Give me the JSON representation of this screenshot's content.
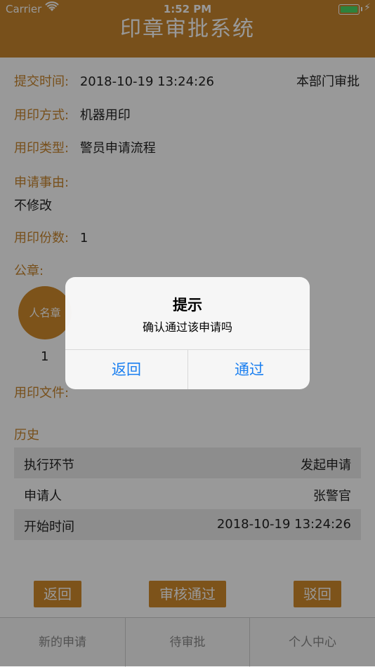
{
  "status_bar": {
    "carrier": "Carrier",
    "time": "1:52 PM"
  },
  "nav": {
    "title": "印章审批系统"
  },
  "detail": {
    "submit_time_label": "提交时间:",
    "submit_time_value": "2018-10-19 13:24:26",
    "dept_status": "本部门审批",
    "method_label": "用印方式:",
    "method_value": "机器用印",
    "type_label": "用印类型:",
    "type_value": "警员申请流程",
    "reason_label": "申请事由:",
    "reason_value": "不修改",
    "copies_label": "用印份数:",
    "copies_value": "1",
    "seal_label": "公章:",
    "seal_name": "人名章",
    "seal_count": "1",
    "files_label": "用印文件:"
  },
  "history": {
    "title": "历史",
    "rows": [
      {
        "key": "执行环节",
        "value": "发起申请"
      },
      {
        "key": "申请人",
        "value": "张警官"
      },
      {
        "key": "开始时间",
        "value": "2018-10-19 13:24:26"
      }
    ]
  },
  "actions": {
    "back": "返回",
    "approve": "审核通过",
    "reject": "驳回"
  },
  "tabbar": {
    "tabs": [
      "新的申请",
      "待审批",
      "个人中心"
    ]
  },
  "alert": {
    "title": "提示",
    "message": "确认通过该申请吗",
    "cancel": "返回",
    "confirm": "通过"
  },
  "colors": {
    "brand": "#c8862e",
    "button": "#d18a2c",
    "alert_button": "#1a7ff0"
  }
}
